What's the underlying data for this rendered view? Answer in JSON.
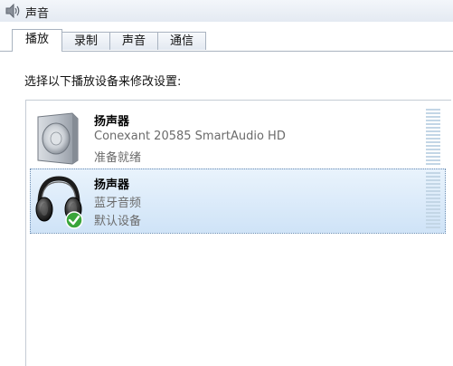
{
  "window": {
    "title": "声音"
  },
  "tabs": [
    {
      "label": "播放",
      "active": true
    },
    {
      "label": "录制",
      "active": false
    },
    {
      "label": "声音",
      "active": false
    },
    {
      "label": "通信",
      "active": false
    }
  ],
  "playback": {
    "instruction": "选择以下播放设备来修改设置:",
    "devices": [
      {
        "name": "扬声器",
        "description": "Conexant 20585 SmartAudio HD",
        "status": "准备就绪",
        "icon": "speaker-icon",
        "selected": false
      },
      {
        "name": "扬声器",
        "description": "蓝牙音频",
        "status": "默认设备",
        "icon": "headphones-icon",
        "default_badge": "check-icon",
        "selected": true
      }
    ]
  },
  "colors": {
    "selection_top": "#e9f3fc",
    "selection_bottom": "#cfe3f7",
    "check_green": "#3aa53a",
    "meter": "#c3d6e6"
  }
}
